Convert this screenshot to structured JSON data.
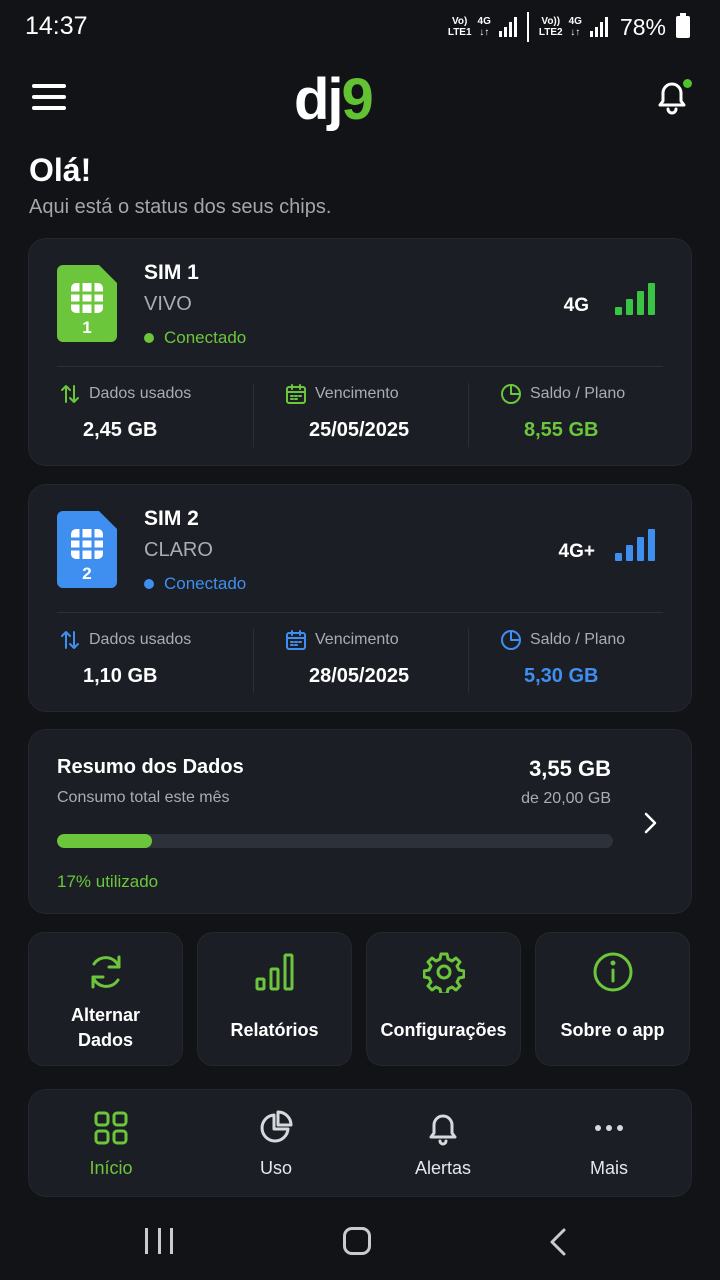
{
  "status_bar": {
    "time": "14:37",
    "sim1_volte": "Vo)",
    "sim1_lte": "LTE1",
    "sim1_net": "4G",
    "sim2_volte": "Vo))",
    "sim2_lte": "LTE2",
    "sim2_net": "4G",
    "battery": "78%"
  },
  "header": {
    "logo_part1": "dj",
    "logo_part2": "9",
    "menu_icon": "hamburger-icon",
    "notification_icon": "bell-icon",
    "has_notification": true
  },
  "greeting": {
    "title": "Olá!",
    "subtitle": "Aqui está o status dos seus chips."
  },
  "sims": [
    {
      "title": "SIM 1",
      "number": "1",
      "carrier": "VIVO",
      "status": "Conectado",
      "network": "4G",
      "accent": "#6cc63b",
      "stats": {
        "used_label": "Dados usados",
        "used_value": "2,45 GB",
        "due_label": "Vencimento",
        "due_value": "25/05/2025",
        "balance_label": "Saldo / Plano",
        "balance_value": "8,55 GB"
      }
    },
    {
      "title": "SIM 2",
      "number": "2",
      "carrier": "CLARO",
      "status": "Conectado",
      "network": "4G+",
      "accent": "#3f8ff0",
      "stats": {
        "used_label": "Dados usados",
        "used_value": "1,10 GB",
        "due_label": "Vencimento",
        "due_value": "28/05/2025",
        "balance_label": "Saldo / Plano",
        "balance_value": "5,30 GB"
      }
    }
  ],
  "summary": {
    "title": "Resumo dos Dados",
    "subtitle": "Consumo total este mês",
    "total": "3,55 GB",
    "plan": "de 20,00 GB",
    "progress": 0.17,
    "percent_text": "17% utilizado"
  },
  "actions": [
    {
      "label_line1": "Alternar",
      "label_line2": "Dados",
      "icon": "refresh-icon"
    },
    {
      "label_line1": "Relatórios",
      "label_line2": "",
      "icon": "bar-chart-icon"
    },
    {
      "label_line1": "Configurações",
      "label_line2": "",
      "icon": "gear-icon"
    },
    {
      "label_line1": "Sobre o app",
      "label_line2": "",
      "icon": "info-icon"
    }
  ],
  "bottom_nav": [
    {
      "label": "Início",
      "icon": "grid-icon",
      "active": true
    },
    {
      "label": "Uso",
      "icon": "pie-chart-icon",
      "active": false
    },
    {
      "label": "Alertas",
      "icon": "bell-icon",
      "active": false
    },
    {
      "label": "Mais",
      "icon": "more-icon",
      "active": false
    }
  ],
  "colors": {
    "brand_green": "#6cc63b",
    "sim2_blue": "#3f8ff0",
    "background": "#111317",
    "card": "#1b1e24"
  }
}
